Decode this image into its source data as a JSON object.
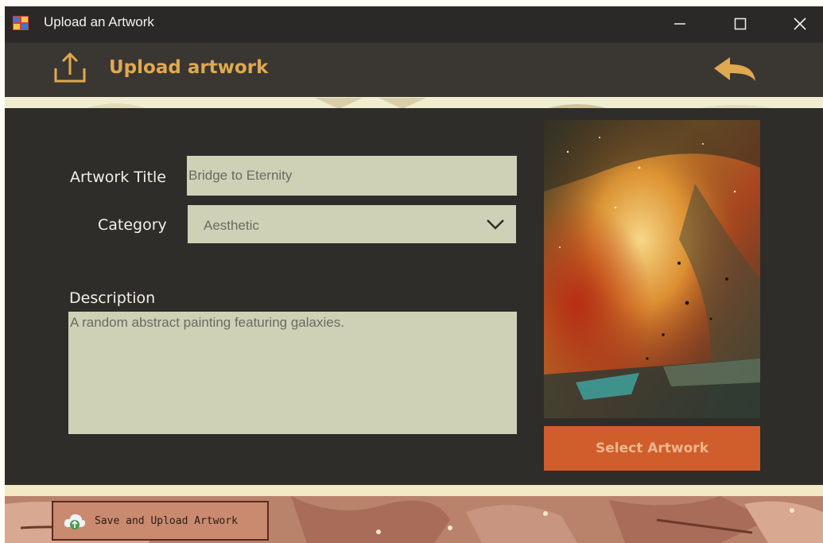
{
  "window": {
    "title": "Upload an Artwork"
  },
  "header": {
    "title": "Upload artwork",
    "upload_icon": "upload-icon",
    "back_icon": "back-arrow-icon"
  },
  "form": {
    "title_label": "Artwork Title",
    "title_value": "Bridge to Eternity",
    "category_label": "Category",
    "category_value": "Aesthetic",
    "description_label": "Description",
    "description_value": "A random abstract painting featuring galaxies."
  },
  "buttons": {
    "select_artwork": "Select Artwork",
    "save_upload": "Save and Upload Artwork"
  },
  "colors": {
    "accent": "#e0a94f",
    "select_button": "#cf5e2c",
    "field_bg": "#cfd1b6",
    "panel_bg": "#2e2d2a"
  }
}
